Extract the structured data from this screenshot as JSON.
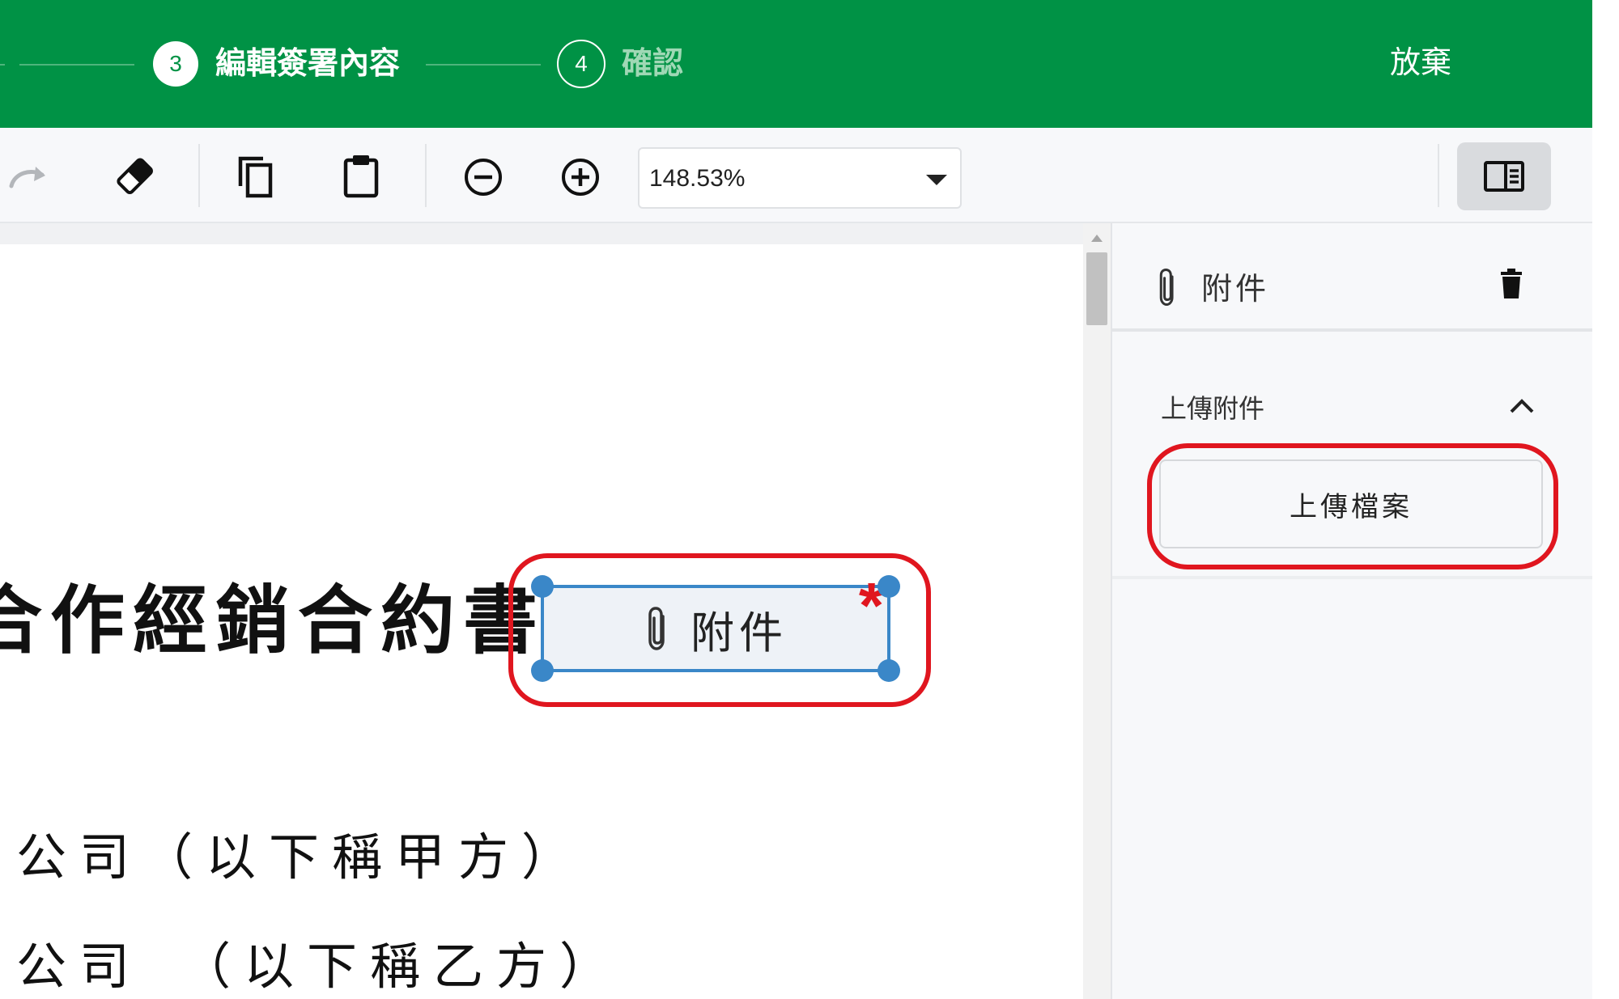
{
  "header": {
    "steps": [
      {
        "number": "3",
        "label": "編輯簽署內容",
        "state": "active"
      },
      {
        "number": "4",
        "label": "確認",
        "state": "inactive"
      }
    ],
    "abandon_label": "放棄"
  },
  "toolbar": {
    "zoom_value": "148.53%",
    "icons": [
      "redo-icon",
      "eraser-icon",
      "copy-icon",
      "paste-icon",
      "zoom-out-icon",
      "zoom-in-icon",
      "panel-toggle-icon"
    ]
  },
  "document": {
    "title": "合作經銷合約書",
    "lines": [
      "公司（以下稱甲方）",
      "公司　（以下稱乙方）"
    ],
    "attachment_field": {
      "label": "附件",
      "required_mark": "*"
    }
  },
  "side_panel": {
    "title": "附件",
    "section_title": "上傳附件",
    "upload_button_label": "上傳檔案"
  },
  "colors": {
    "brand_green": "#009245",
    "selection_blue": "#3a87c8",
    "highlight_red": "#e0161f"
  }
}
